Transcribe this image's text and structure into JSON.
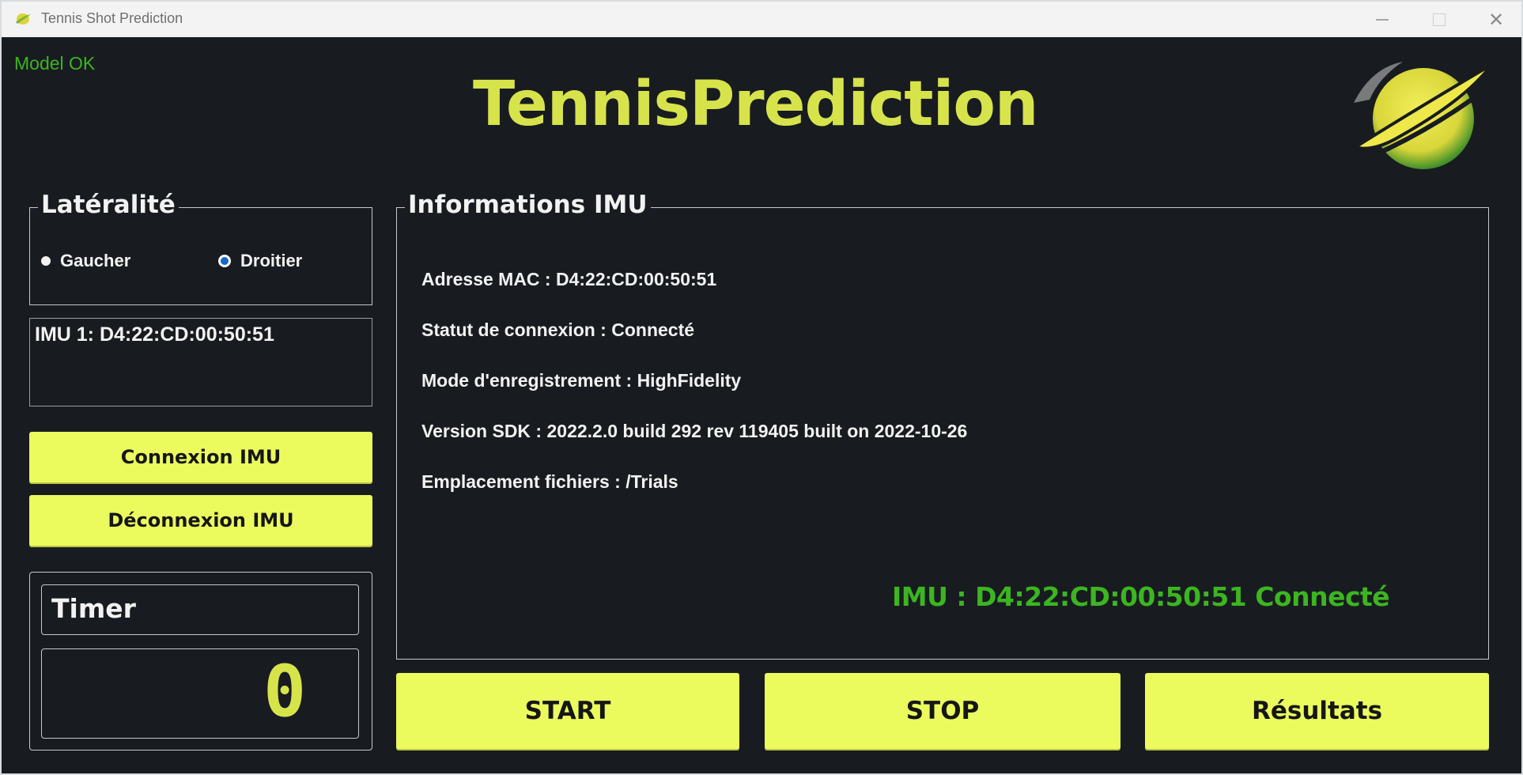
{
  "window": {
    "title": "Tennis Shot Prediction",
    "controls": {
      "minimize": "minimize",
      "maximize": "maximize",
      "close": "✕"
    }
  },
  "status": {
    "model": "Model OK"
  },
  "header": {
    "app_title": "TennisPrediction"
  },
  "laterality": {
    "legend": "Latéralité",
    "options": [
      {
        "label": "Gaucher",
        "selected": false
      },
      {
        "label": "Droitier",
        "selected": true
      }
    ]
  },
  "imu_list": {
    "items": [
      "IMU 1: D4:22:CD:00:50:51"
    ]
  },
  "buttons": {
    "connect": "Connexion IMU",
    "disconnect": "Déconnexion IMU",
    "start": "START",
    "stop": "STOP",
    "results": "Résultats"
  },
  "timer": {
    "label": "Timer",
    "value": "0"
  },
  "info": {
    "legend": "Informations IMU",
    "lines": [
      "Adresse MAC : D4:22:CD:00:50:51",
      "Statut de connexion : Connecté",
      "Mode d'enregistrement : HighFidelity",
      "Version SDK : 2022.2.0 build 292 rev 119405 built on 2022-10-26",
      "Emplacement fichiers : /Trials"
    ],
    "connection_status": "IMU : D4:22:CD:00:50:51 Connecté"
  },
  "colors": {
    "background": "#181c20",
    "accent": "#ebfb5e",
    "title_yellow": "#d7e34b",
    "status_green": "#3cb521"
  }
}
